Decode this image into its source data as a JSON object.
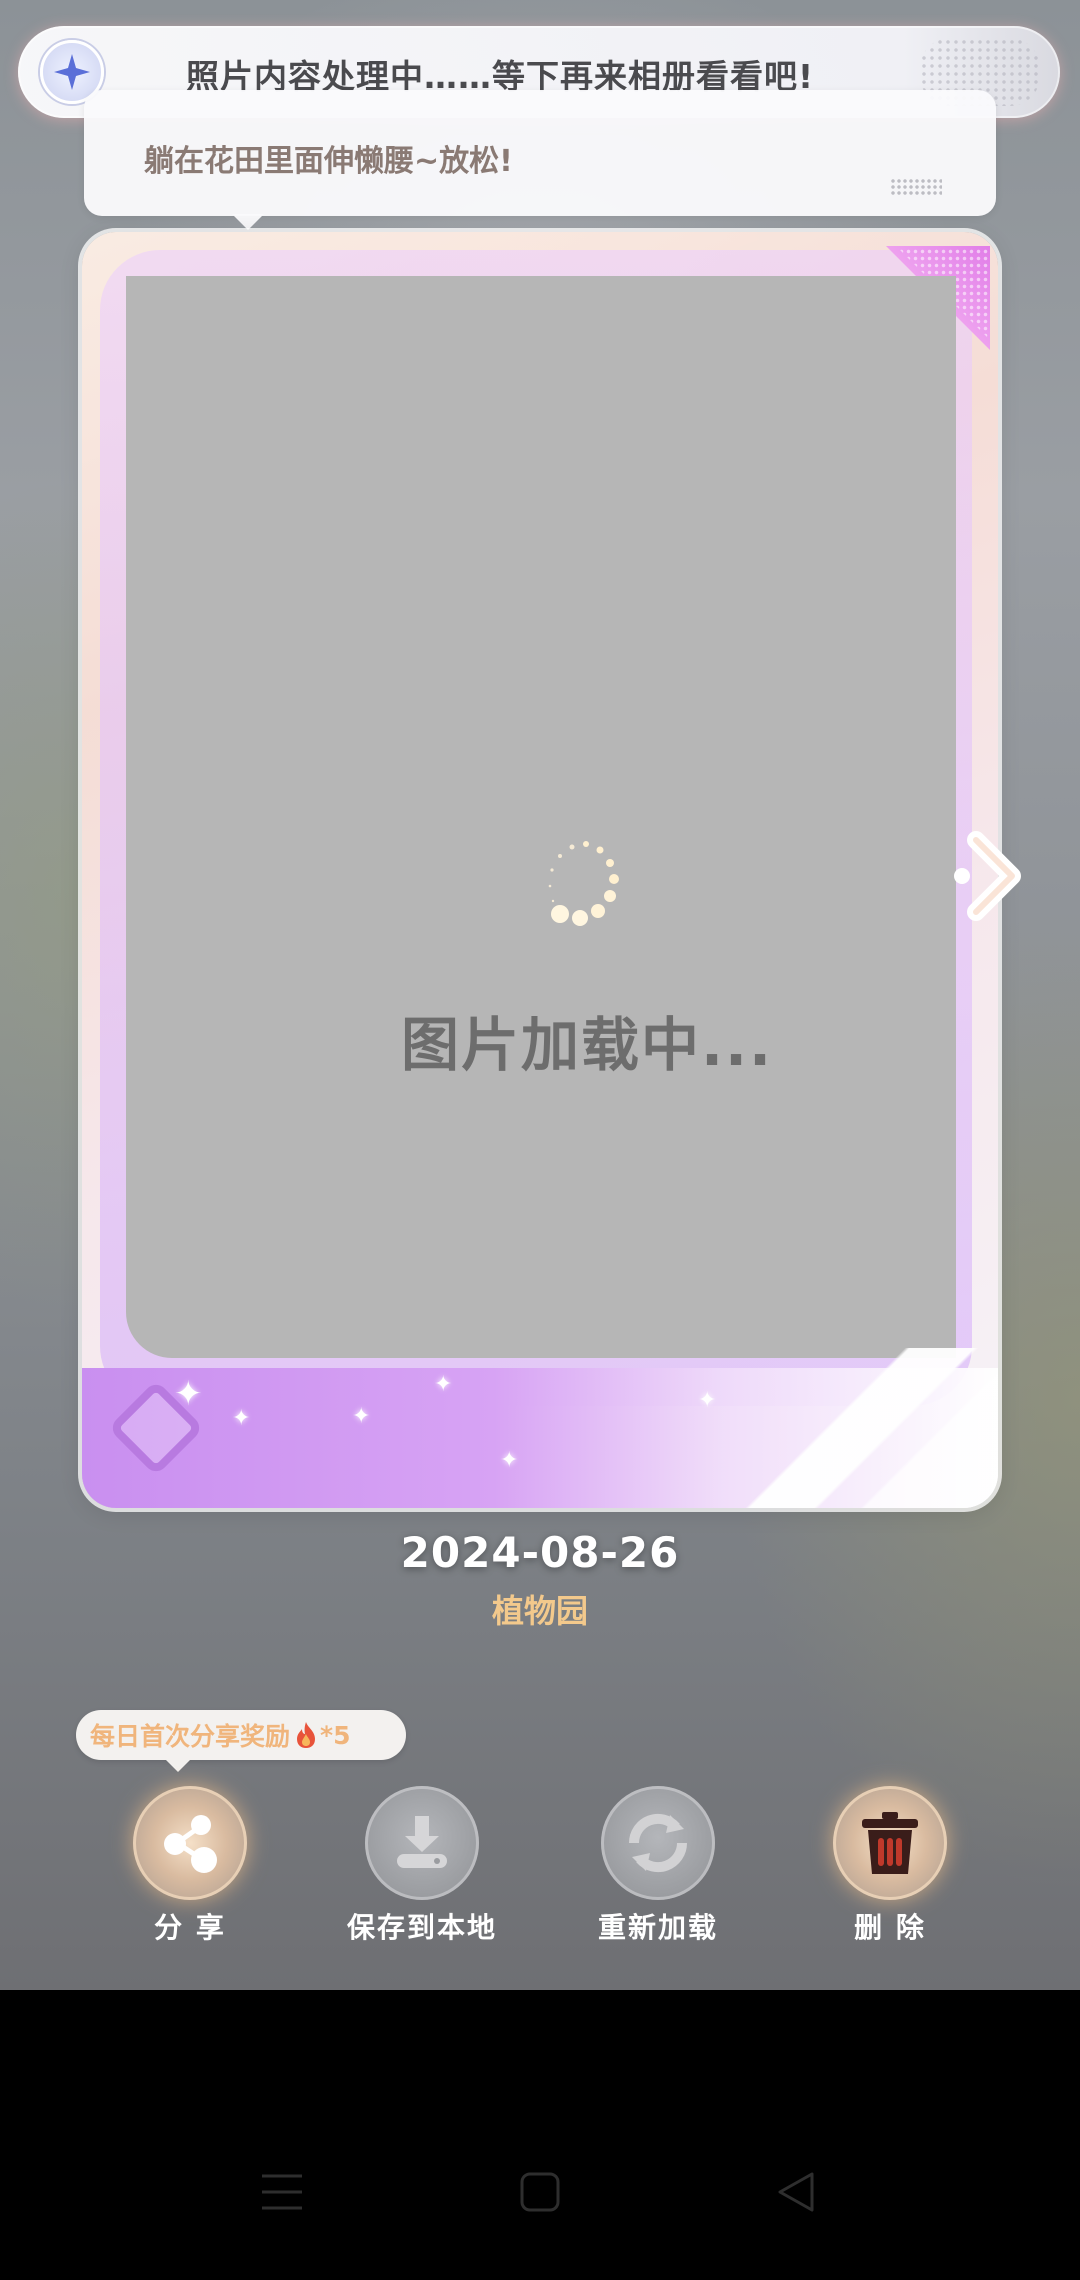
{
  "notification": {
    "icon": "sparkle-star-icon",
    "text": "照片内容处理中……等下再来相册看看吧!"
  },
  "bubble": {
    "caption": "躺在花田里面伸懒腰~放松!"
  },
  "photo": {
    "loading_text": "图片加载中..."
  },
  "meta": {
    "date": "2024-08-26",
    "location": "植物园"
  },
  "reward": {
    "text": "每日首次分享奖励",
    "icon": "flame-icon",
    "count": "*5"
  },
  "actions": [
    {
      "label": "分 享",
      "icon": "share-icon"
    },
    {
      "label": "保存到本地",
      "icon": "download-icon"
    },
    {
      "label": "重新加载",
      "icon": "reload-icon"
    },
    {
      "label": "删 除",
      "icon": "trash-icon"
    }
  ],
  "colors": {
    "accent_purple": "#c98ff0",
    "location_gold": "#f3c98c",
    "placeholder_gray": "#b6b6b6"
  }
}
